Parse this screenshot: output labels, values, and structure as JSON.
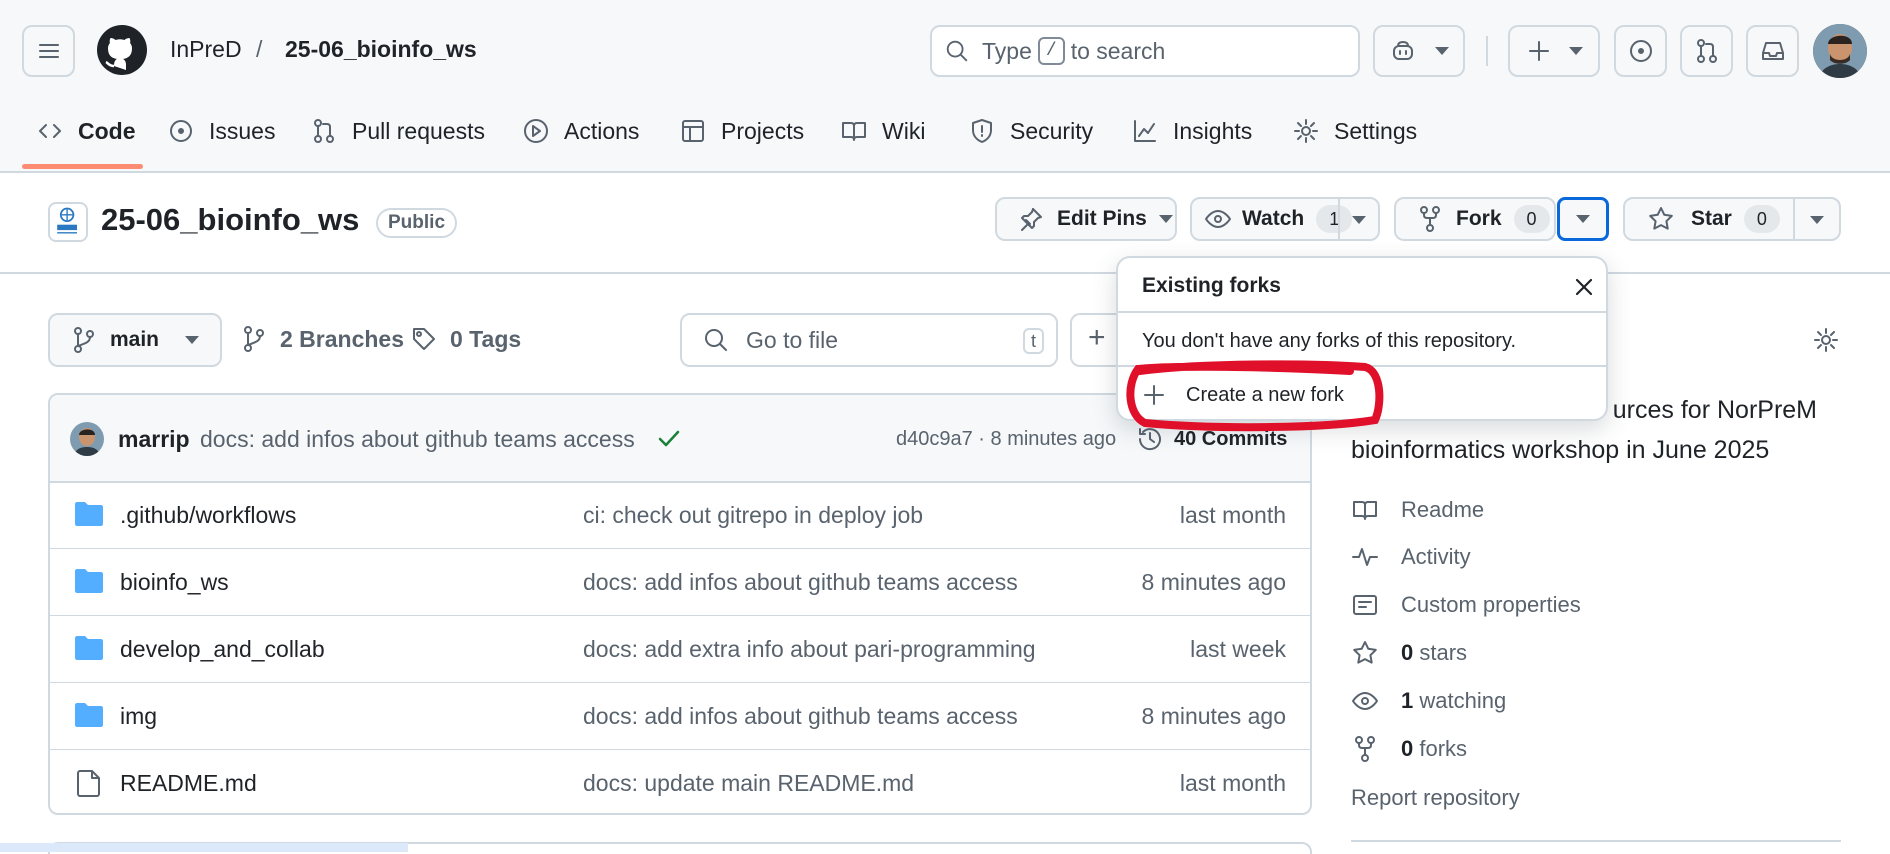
{
  "header": {
    "org": "InPreD",
    "separator": "/",
    "repo": "25-06_bioinfo_ws",
    "search_before": "Type",
    "search_key": "/",
    "search_after": "to search"
  },
  "tabs": [
    {
      "label": "Code",
      "icon": "code-icon"
    },
    {
      "label": "Issues",
      "icon": "issue-icon"
    },
    {
      "label": "Pull requests",
      "icon": "pull-request-icon"
    },
    {
      "label": "Actions",
      "icon": "play-icon"
    },
    {
      "label": "Projects",
      "icon": "table-icon"
    },
    {
      "label": "Wiki",
      "icon": "book-icon"
    },
    {
      "label": "Security",
      "icon": "shield-icon"
    },
    {
      "label": "Insights",
      "icon": "graph-icon"
    },
    {
      "label": "Settings",
      "icon": "gear-icon"
    }
  ],
  "repo_header": {
    "name": "25-06_bioinfo_ws",
    "visibility": "Public",
    "edit_pins": "Edit Pins",
    "watch": "Watch",
    "watch_count": "1",
    "fork": "Fork",
    "fork_count": "0",
    "star": "Star",
    "star_count": "0"
  },
  "toolbar": {
    "branch": "main",
    "branches": "2 Branches",
    "tags": "0 Tags",
    "goto_placeholder": "Go to file",
    "goto_key": "t",
    "add_label": "+"
  },
  "commit": {
    "author": "marrip",
    "message": "docs: add infos about github teams access",
    "hash_time": "d40c9a7 · 8 minutes ago",
    "commits": "40 Commits"
  },
  "files": [
    {
      "name": ".github/workflows",
      "type": "folder",
      "message": "ci: check out gitrepo in deploy job",
      "date": "last month"
    },
    {
      "name": "bioinfo_ws",
      "type": "folder",
      "message": "docs: add infos about github teams access",
      "date": "8 minutes ago"
    },
    {
      "name": "develop_and_collab",
      "type": "folder",
      "message": "docs: add extra info about pari-programming",
      "date": "last week"
    },
    {
      "name": "img",
      "type": "folder",
      "message": "docs: add infos about github teams access",
      "date": "8 minutes ago"
    },
    {
      "name": "README.md",
      "type": "file",
      "message": "docs: update main README.md",
      "date": "last month"
    }
  ],
  "about": {
    "desc_line1": "urces for NorPreM",
    "desc_line2": "bioinformatics workshop in June 2025",
    "readme": "Readme",
    "activity": "Activity",
    "custom_properties": "Custom properties",
    "stars_count": "0",
    "stars_label": "stars",
    "watching_count": "1",
    "watching_label": "watching",
    "forks_count": "0",
    "forks_label": "forks",
    "report": "Report repository"
  },
  "popover": {
    "title": "Existing forks",
    "body": "You don't have any forks of this repository.",
    "action": "Create a new fork"
  },
  "colors": {
    "accent_underline": "#fd8c73",
    "folder": "#54aeff",
    "check": "#1a7f37",
    "annotation_red": "#e0102a",
    "focus_blue": "#0969da"
  }
}
